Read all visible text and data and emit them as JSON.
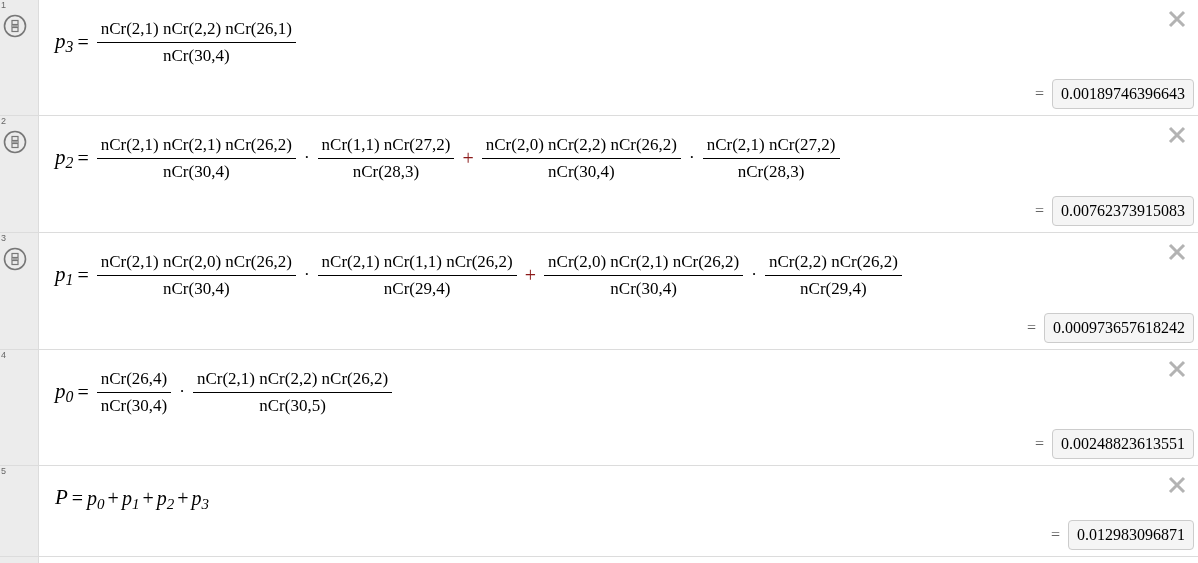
{
  "expressions": [
    {
      "number": "1",
      "fraction_toggle": true,
      "lhs": "p$_{3}$",
      "equals": "=",
      "rhs": [
        {
          "kind": "fraction",
          "numerator": "nCr(2,1) nCr(2,2) nCr(26,1)",
          "denominator": "nCr(30,4)"
        }
      ],
      "result_equals": "=",
      "result": "0.00189746396643"
    },
    {
      "number": "2",
      "fraction_toggle": true,
      "lhs": "p$_{2}$",
      "equals": "=",
      "rhs": [
        {
          "kind": "fraction",
          "numerator": "nCr(2,1) nCr(2,1) nCr(26,2)",
          "denominator": "nCr(30,4)"
        },
        {
          "kind": "dot",
          "text": "·"
        },
        {
          "kind": "fraction",
          "numerator": "nCr(1,1) nCr(27,2)",
          "denominator": "nCr(28,3)"
        },
        {
          "kind": "plus",
          "text": "+"
        },
        {
          "kind": "fraction",
          "numerator": "nCr(2,0) nCr(2,2) nCr(26,2)",
          "denominator": "nCr(30,4)"
        },
        {
          "kind": "dot",
          "text": "·"
        },
        {
          "kind": "fraction",
          "numerator": "nCr(2,1) nCr(27,2)",
          "denominator": "nCr(28,3)"
        }
      ],
      "result_equals": "=",
      "result": "0.00762373915083"
    },
    {
      "number": "3",
      "fraction_toggle": true,
      "lhs": "p$_{1}$",
      "equals": "=",
      "rhs": [
        {
          "kind": "fraction",
          "numerator": "nCr(2,1) nCr(2,0) nCr(26,2)",
          "denominator": "nCr(30,4)"
        },
        {
          "kind": "dot",
          "text": "·"
        },
        {
          "kind": "fraction",
          "numerator": "nCr(2,1) nCr(1,1) nCr(26,2)",
          "denominator": "nCr(29,4)"
        },
        {
          "kind": "plus",
          "text": "+"
        },
        {
          "kind": "fraction",
          "numerator": "nCr(2,0) nCr(2,1) nCr(26,2)",
          "denominator": "nCr(30,4)"
        },
        {
          "kind": "dot",
          "text": "·"
        },
        {
          "kind": "fraction",
          "numerator": "nCr(2,2) nCr(26,2)",
          "denominator": "nCr(29,4)"
        }
      ],
      "result_equals": "=",
      "result": "0.000973657618242"
    },
    {
      "number": "4",
      "fraction_toggle": false,
      "lhs": "p$_{0}$",
      "equals": "=",
      "rhs": [
        {
          "kind": "fraction",
          "numerator": "nCr(26,4)",
          "denominator": "nCr(30,4)"
        },
        {
          "kind": "dot",
          "text": "·"
        },
        {
          "kind": "fraction",
          "numerator": "nCr(2,1) nCr(2,2) nCr(26,2)",
          "denominator": "nCr(30,5)"
        }
      ],
      "result_equals": "=",
      "result": "0.00248823613551"
    },
    {
      "number": "5",
      "fraction_toggle": false,
      "lhs": "P",
      "equals": "=",
      "rhs": [
        {
          "kind": "term",
          "text": "p$_{0}$"
        },
        {
          "kind": "add",
          "text": "+"
        },
        {
          "kind": "term",
          "text": "p$_{1}$"
        },
        {
          "kind": "add",
          "text": "+"
        },
        {
          "kind": "term",
          "text": "p$_{2}$"
        },
        {
          "kind": "add",
          "text": "+"
        },
        {
          "kind": "term",
          "text": "p$_{3}$"
        }
      ],
      "result_equals": "=",
      "result": "0.012983096871"
    }
  ]
}
